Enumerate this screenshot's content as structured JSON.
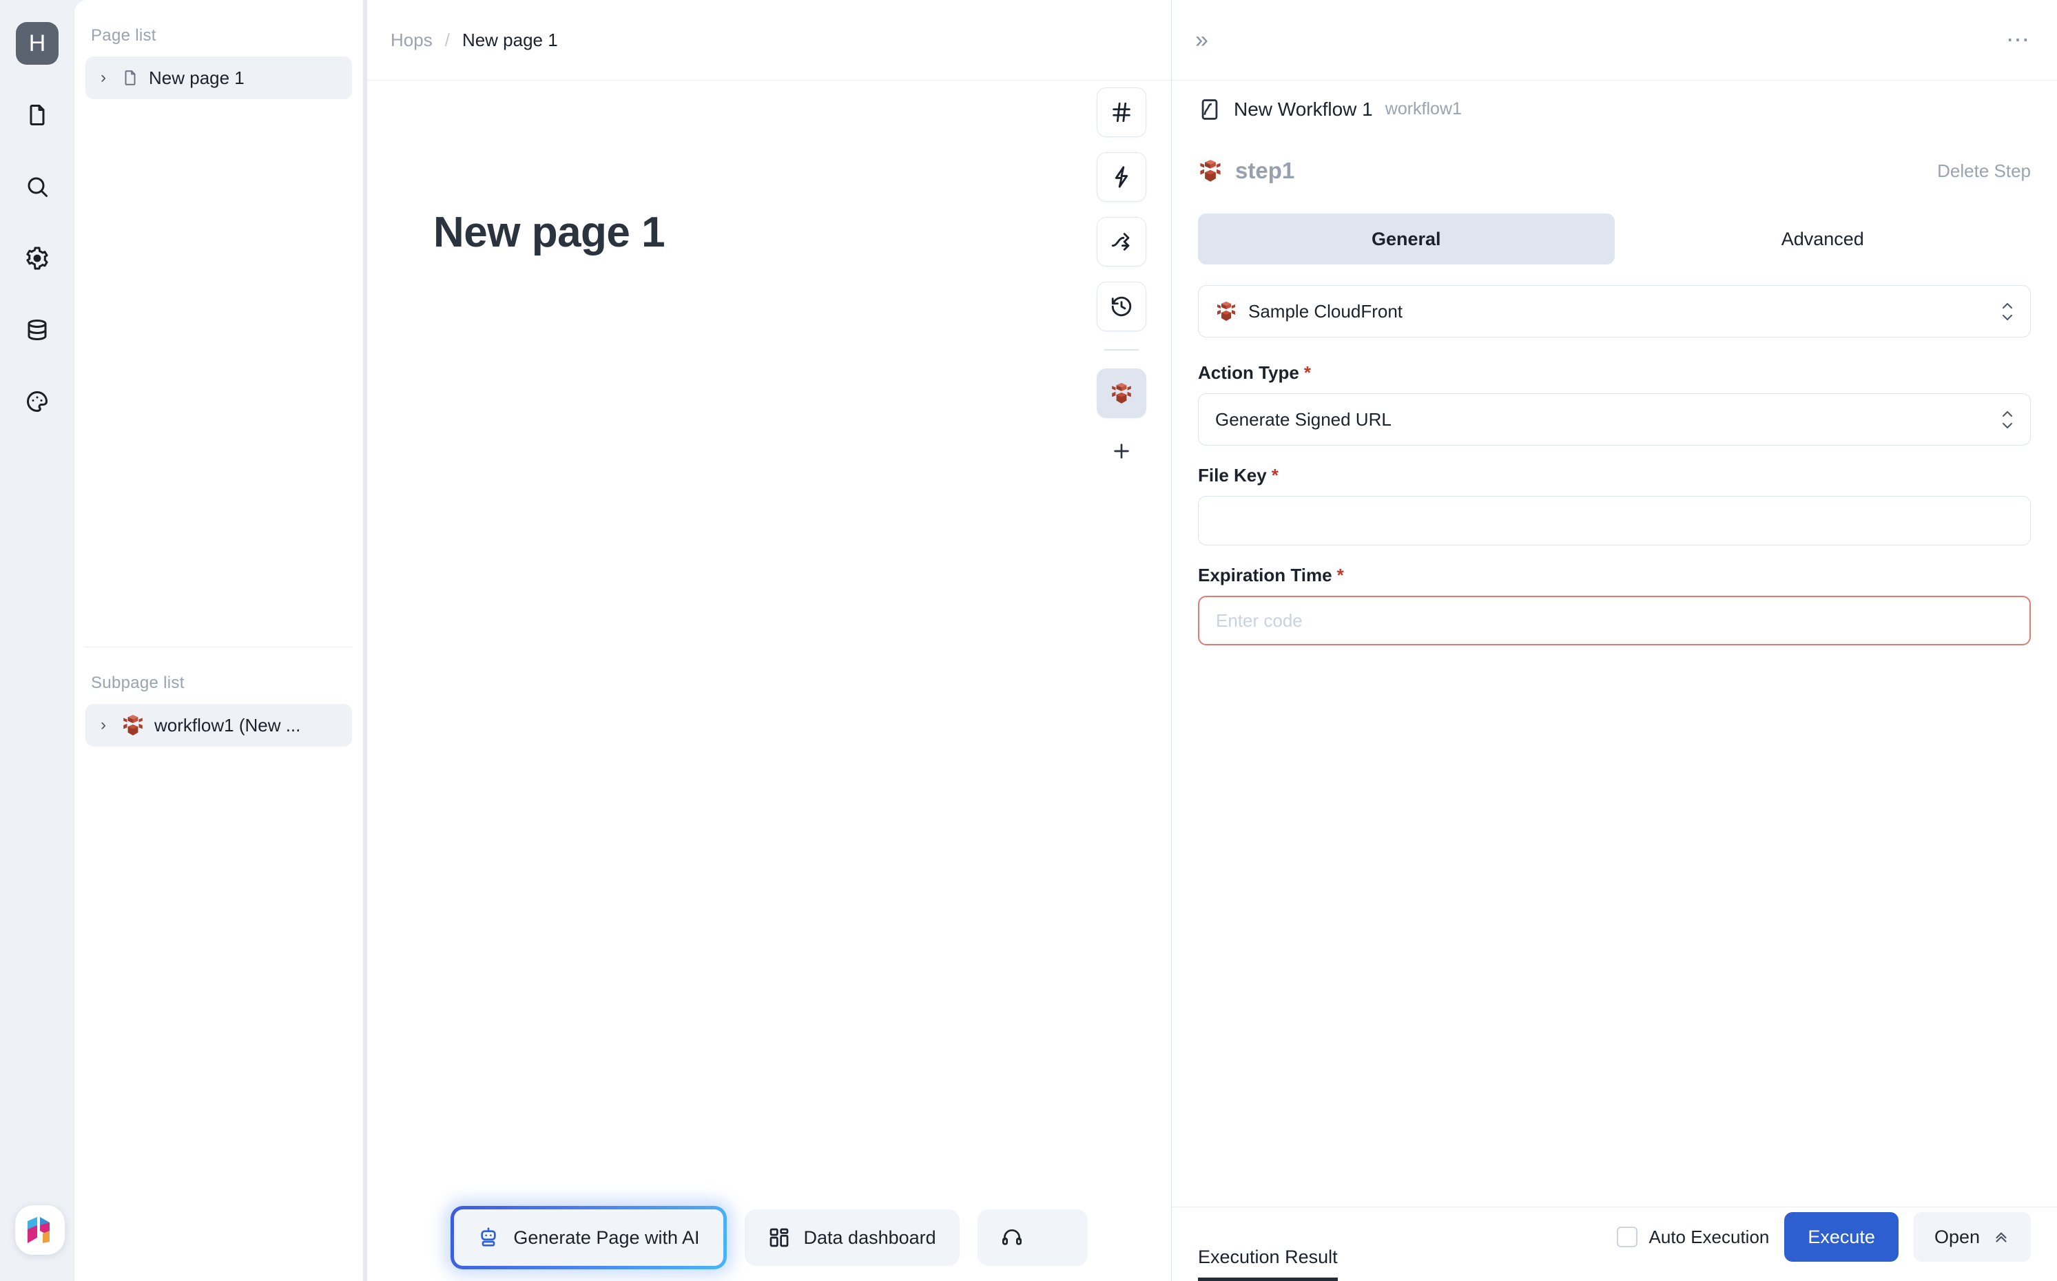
{
  "rail": {
    "avatar_initial": "H",
    "icons": [
      {
        "name": "document-icon"
      },
      {
        "name": "search-icon"
      },
      {
        "name": "gear-icon"
      },
      {
        "name": "database-icon"
      },
      {
        "name": "palette-icon"
      }
    ],
    "brand_logo": "hops-logo"
  },
  "pagelist": {
    "page_section_label": "Page list",
    "page_items": [
      {
        "label": "New page 1",
        "icon": "file-icon"
      }
    ],
    "subpage_section_label": "Subpage list",
    "subpage_items": [
      {
        "label": "workflow1 (New ...",
        "icon": "aws-cloudfront-icon"
      }
    ]
  },
  "breadcrumb": {
    "root": "Hops",
    "separator": "/",
    "current": "New page 1"
  },
  "canvas": {
    "title": "New page 1",
    "toolstrip": [
      {
        "name": "hash-icon",
        "active": false
      },
      {
        "name": "lightning-icon",
        "active": false
      },
      {
        "name": "branch-icon",
        "active": false
      },
      {
        "name": "history-icon",
        "active": false
      },
      {
        "name": "aws-cloudfront-icon",
        "active": true
      }
    ],
    "add_label": "+",
    "bottom_buttons": [
      {
        "label": "Generate Page with AI",
        "icon": "robot-icon",
        "featured": true
      },
      {
        "label": "Data dashboard",
        "icon": "dashboard-icon",
        "featured": false
      },
      {
        "label": "",
        "icon": "headset-icon",
        "featured": false
      }
    ]
  },
  "panel": {
    "expand_icon": "chevrons-right-icon",
    "more_icon": "ellipsis-icon",
    "workflow": {
      "icon": "workflow-icon",
      "name": "New Workflow 1",
      "slug": "workflow1"
    },
    "step": {
      "icon": "aws-cloudfront-icon",
      "name": "step1",
      "delete_label": "Delete Step"
    },
    "tabs": [
      {
        "label": "General",
        "active": true
      },
      {
        "label": "Advanced",
        "active": false
      }
    ],
    "connection": {
      "value": "Sample CloudFront",
      "icon": "aws-cloudfront-icon"
    },
    "fields": [
      {
        "label": "Action Type",
        "required": true,
        "type": "select",
        "value": "Generate Signed URL",
        "placeholder": "",
        "error": false
      },
      {
        "label": "File Key",
        "required": true,
        "type": "text",
        "value": "",
        "placeholder": "",
        "error": false
      },
      {
        "label": "Expiration Time",
        "required": true,
        "type": "code",
        "value": "",
        "placeholder": "Enter code",
        "error": true
      }
    ],
    "footer": {
      "result_tab": "Execution Result",
      "auto_execution_label": "Auto Execution",
      "auto_execution_checked": false,
      "execute_label": "Execute",
      "open_label": "Open",
      "open_icon": "chevrons-up-icon"
    }
  },
  "colors": {
    "accent_blue": "#2d5fd0",
    "aws_red": "#b5432f",
    "error_red": "#dd7b74",
    "panel_bg": "#ffffff",
    "app_bg": "#eef1f6",
    "muted_text": "#9aa3b0"
  }
}
